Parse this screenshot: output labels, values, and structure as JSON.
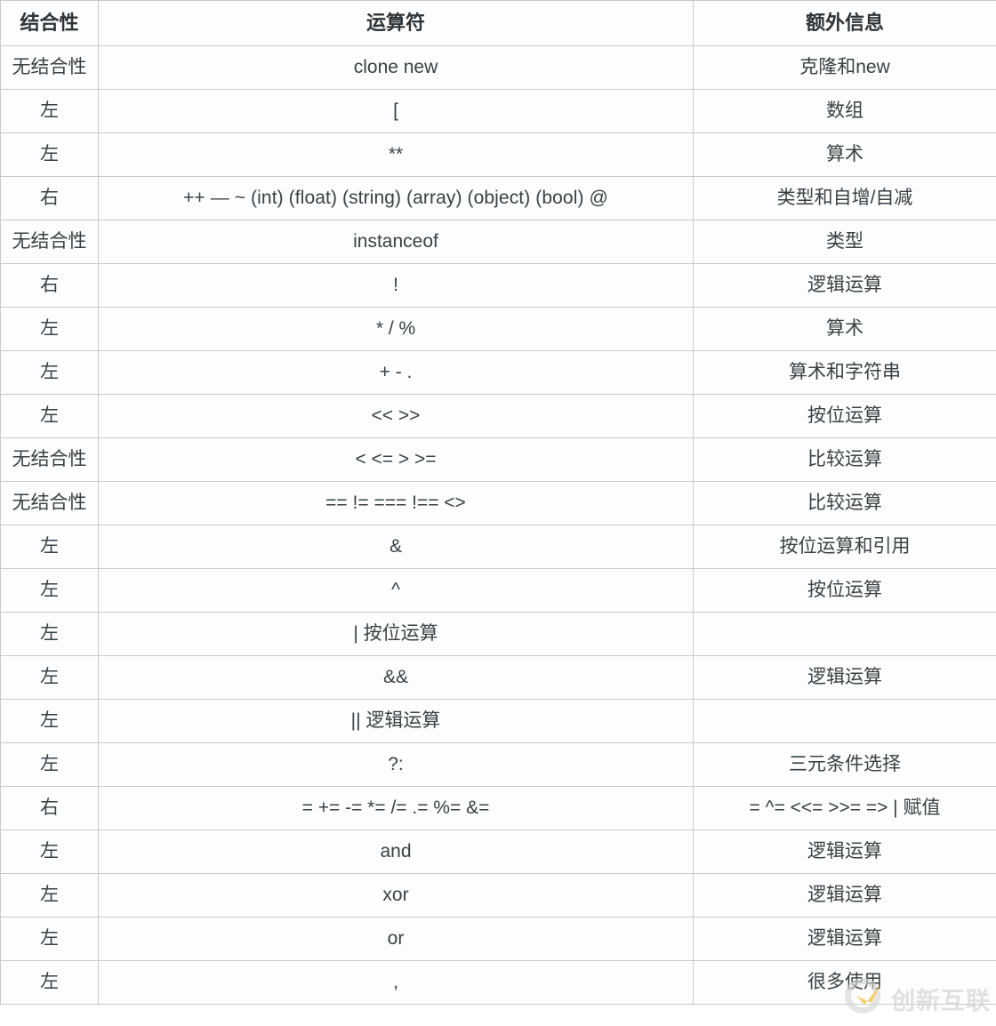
{
  "table": {
    "headers": [
      "结合性",
      "运算符",
      "额外信息"
    ],
    "rows": [
      {
        "assoc": "无结合性",
        "operator": "clone new",
        "extra": "克隆和new"
      },
      {
        "assoc": "左",
        "operator": "[",
        "extra": "数组"
      },
      {
        "assoc": "左",
        "operator": "**",
        "extra": "算术"
      },
      {
        "assoc": "右",
        "operator": "++ — ~ (int) (float) (string) (array) (object) (bool) @",
        "extra": "类型和自增/自减"
      },
      {
        "assoc": "无结合性",
        "operator": "instanceof",
        "extra": "类型"
      },
      {
        "assoc": "右",
        "operator": "!",
        "extra": "逻辑运算"
      },
      {
        "assoc": "左",
        "operator": "* / %",
        "extra": "算术"
      },
      {
        "assoc": "左",
        "operator": "+ - .",
        "extra": "算术和字符串"
      },
      {
        "assoc": "左",
        "operator": "<< >>",
        "extra": "按位运算"
      },
      {
        "assoc": "无结合性",
        "operator": "< <= > >=",
        "extra": "比较运算"
      },
      {
        "assoc": "无结合性",
        "operator": "== != === !== <>",
        "extra": "比较运算"
      },
      {
        "assoc": "左",
        "operator": "&",
        "extra": "按位运算和引用"
      },
      {
        "assoc": "左",
        "operator": "^",
        "extra": "按位运算"
      },
      {
        "assoc": "左",
        "operator": "| 按位运算",
        "extra": ""
      },
      {
        "assoc": "左",
        "operator": "&&",
        "extra": "逻辑运算"
      },
      {
        "assoc": "左",
        "operator": "|| 逻辑运算",
        "extra": ""
      },
      {
        "assoc": "左",
        "operator": "?:",
        "extra": "三元条件选择"
      },
      {
        "assoc": "右",
        "operator": "= += -= *= /= .= %= &=",
        "extra": "= ^= <<= >>= => | 赋值"
      },
      {
        "assoc": "左",
        "operator": "and",
        "extra": "逻辑运算"
      },
      {
        "assoc": "左",
        "operator": "xor",
        "extra": "逻辑运算"
      },
      {
        "assoc": "左",
        "operator": "or",
        "extra": "逻辑运算"
      },
      {
        "assoc": "左",
        "operator": ",",
        "extra": "很多使用"
      }
    ]
  },
  "watermark": {
    "text": "创新互联",
    "logo_icon": "circle-check-logo-icon"
  },
  "colors": {
    "border": "#c9c9c9",
    "text": "#3b4044",
    "background": "#fdfdfd",
    "watermark_gray": "#cfcfcf",
    "watermark_accent": "#f0b418"
  }
}
